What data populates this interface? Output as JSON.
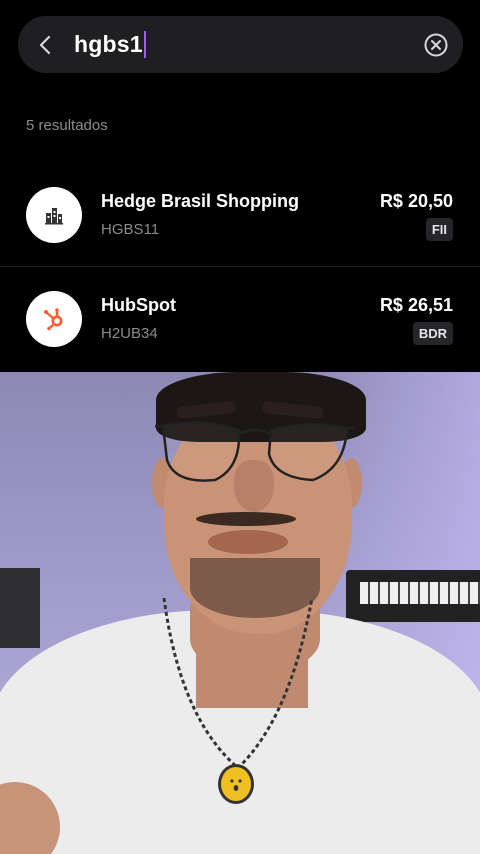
{
  "search": {
    "query": "hgbs1",
    "back_icon": "chevron-left-icon",
    "clear_icon": "clear-circle-icon"
  },
  "results": {
    "count_label": "5 resultados",
    "items": [
      {
        "name": "Hedge Brasil Shopping",
        "ticker": "HGBS11",
        "price": "R$ 20,50",
        "badge": "FII",
        "logo_icon": "building-icon"
      },
      {
        "name": "HubSpot",
        "ticker": "H2UB34",
        "price": "R$ 26,51",
        "badge": "BDR",
        "logo_icon": "hubspot-logo-icon",
        "logo_color": "#ff5c35"
      }
    ]
  },
  "colors": {
    "caret": "#9a5cff",
    "background": "#000000",
    "search_bg": "#1f1f22"
  }
}
